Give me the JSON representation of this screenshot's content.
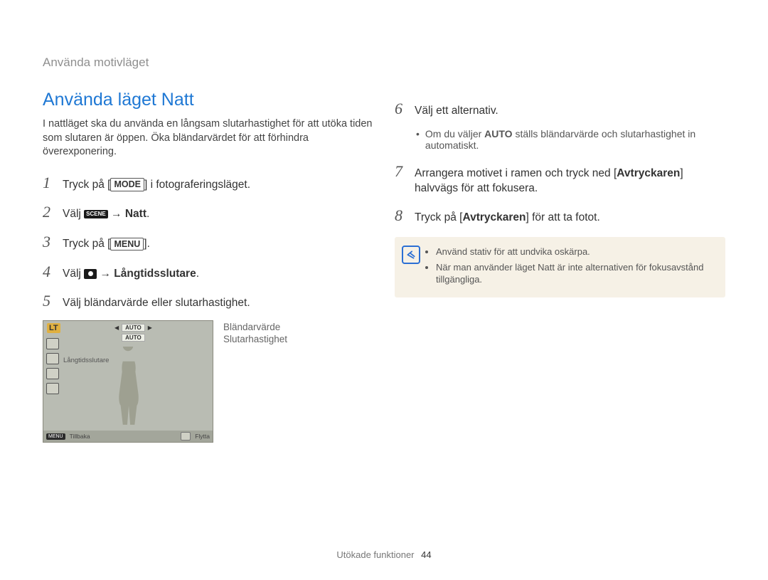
{
  "breadcrumb": "Använda motivläget",
  "section_title": "Använda läget Natt",
  "intro": "I nattläget ska du använda en långsam slutarhastighet för att utöka tiden som slutaren är öppen. Öka bländarvärdet för att förhindra överexponering.",
  "steps_left": [
    {
      "n": "1",
      "pre": "Tryck på [",
      "key": "MODE",
      "post": "] i fotograferingsläget."
    },
    {
      "n": "2",
      "pre": "Välj ",
      "scene_key": "SCENE",
      "arrow": " → ",
      "bold_after": "Natt",
      "post": "."
    },
    {
      "n": "3",
      "pre": "Tryck på [",
      "key": "MENU",
      "post": "]."
    },
    {
      "n": "4",
      "pre": "Välj ",
      "camera_icon": true,
      "arrow": " → ",
      "bold_after": "Långtidsslutare",
      "post": "."
    },
    {
      "n": "5",
      "pre": "Välj bländarvärde eller slutarhastighet."
    }
  ],
  "lcd": {
    "lt": "LT",
    "aperture_sel": "AUTO",
    "shutter_sel": "AUTO",
    "overlay_label": "Långtidsslutare",
    "bottom_menu_key": "MENU",
    "bottom_back": "Tillbaka",
    "bottom_move": "Flytta"
  },
  "lcd_labels": {
    "top": "Bländarvärde",
    "bottom": "Slutarhastighet"
  },
  "steps_right": [
    {
      "n": "6",
      "pre": "Välj ett alternativ."
    },
    {
      "n": "7",
      "html": "Arrangera motivet i ramen och tryck ned [<b>Avtryckaren</b>] halvvägs för att fokusera."
    },
    {
      "n": "8",
      "html": "Tryck på [<b>Avtryckaren</b>] för att ta fotot."
    }
  ],
  "sub_bullet_6": "Om du väljer <b>AUTO</b> ställs bländarvärde och slutarhastighet in automatiskt.",
  "notes": [
    "Använd stativ för att undvika oskärpa.",
    "När man använder läget Natt är inte alternativen för fokusavstånd tillgängliga."
  ],
  "footer_text": "Utökade funktioner",
  "footer_page": "44"
}
